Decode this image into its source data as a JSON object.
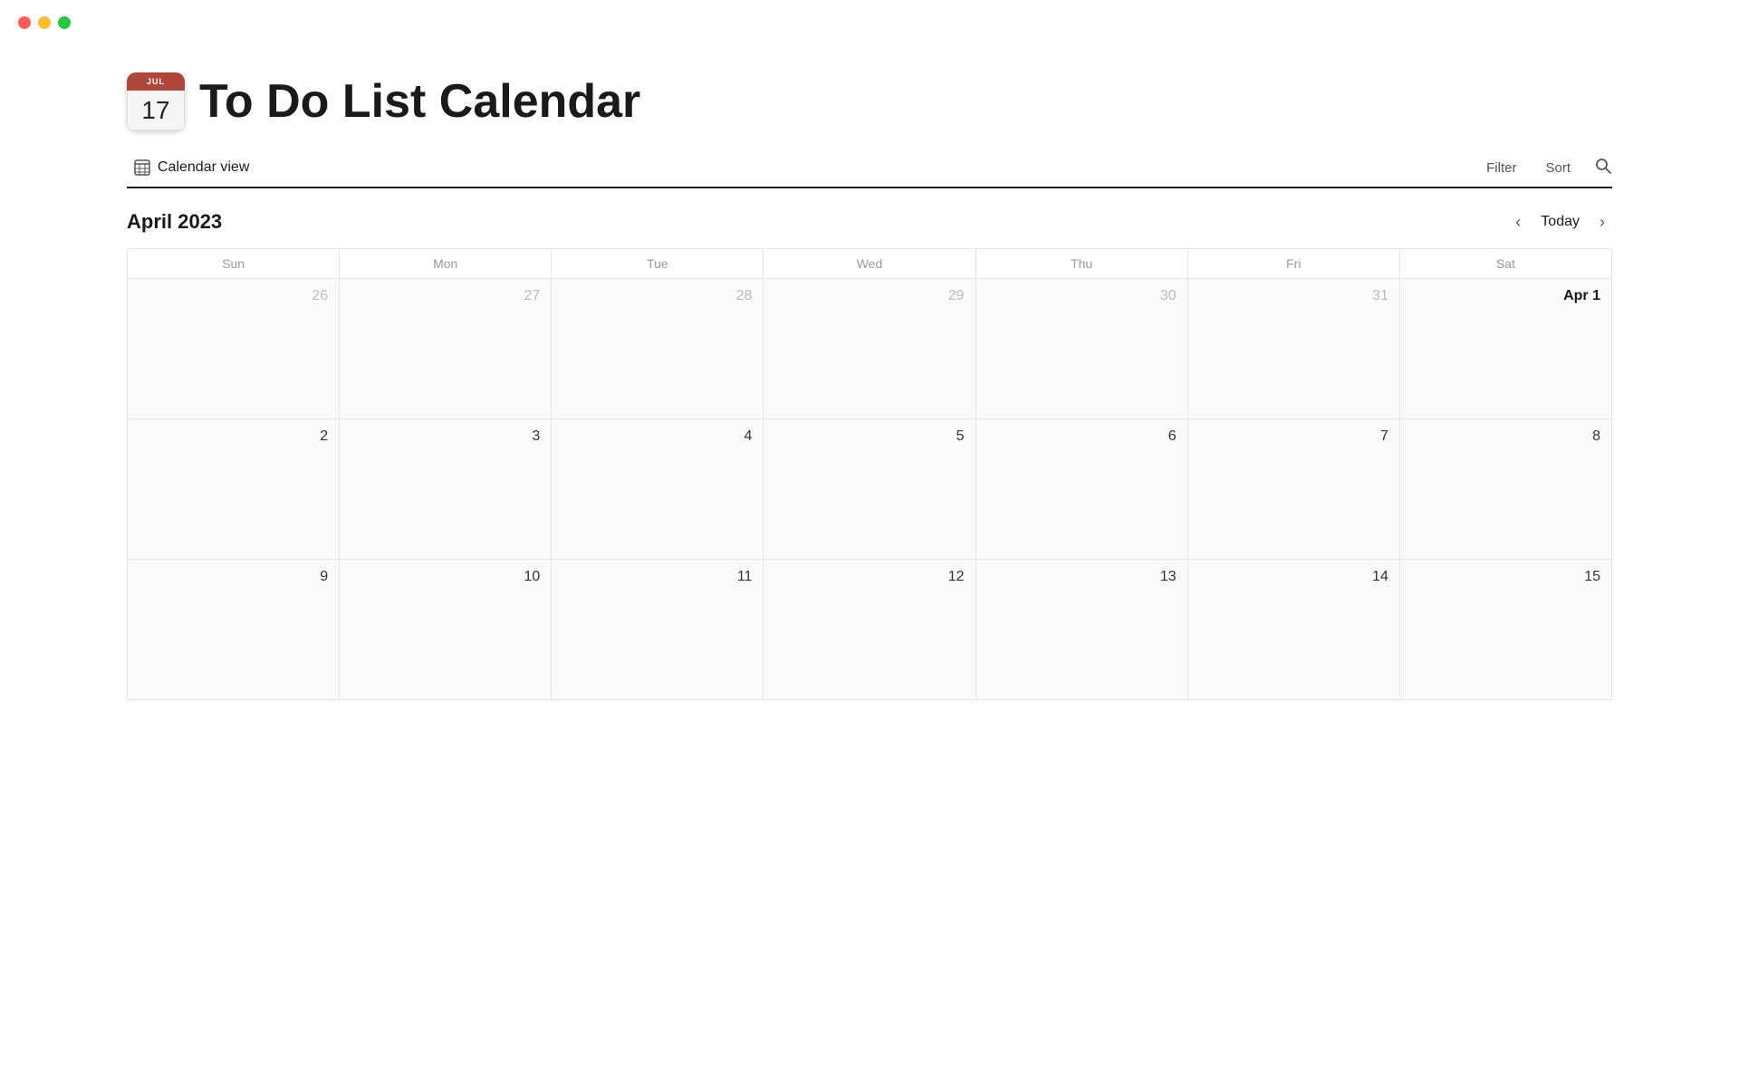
{
  "app": {
    "title": "To Do List Calendar"
  },
  "traffic_lights": {
    "red_label": "close",
    "yellow_label": "minimize",
    "green_label": "maximize"
  },
  "calendar_icon": {
    "month": "JUL",
    "day": "17"
  },
  "toolbar": {
    "view_label": "Calendar view",
    "filter_label": "Filter",
    "sort_label": "Sort"
  },
  "calendar": {
    "month_year": "April 2023",
    "today_label": "Today",
    "days_of_week": [
      "Sun",
      "Mon",
      "Tue",
      "Wed",
      "Thu",
      "Fri",
      "Sat"
    ],
    "weeks": [
      [
        {
          "number": "26",
          "type": "prev"
        },
        {
          "number": "27",
          "type": "prev"
        },
        {
          "number": "28",
          "type": "prev"
        },
        {
          "number": "29",
          "type": "prev"
        },
        {
          "number": "30",
          "type": "prev"
        },
        {
          "number": "31",
          "type": "prev"
        },
        {
          "number": "Apr 1",
          "type": "first"
        }
      ],
      [
        {
          "number": "2",
          "type": "current"
        },
        {
          "number": "3",
          "type": "current"
        },
        {
          "number": "4",
          "type": "current"
        },
        {
          "number": "5",
          "type": "current"
        },
        {
          "number": "6",
          "type": "current"
        },
        {
          "number": "7",
          "type": "current"
        },
        {
          "number": "8",
          "type": "current"
        }
      ],
      [
        {
          "number": "9",
          "type": "current"
        },
        {
          "number": "10",
          "type": "current"
        },
        {
          "number": "11",
          "type": "current"
        },
        {
          "number": "12",
          "type": "current"
        },
        {
          "number": "13",
          "type": "current"
        },
        {
          "number": "14",
          "type": "current"
        },
        {
          "number": "15",
          "type": "current"
        }
      ]
    ]
  }
}
